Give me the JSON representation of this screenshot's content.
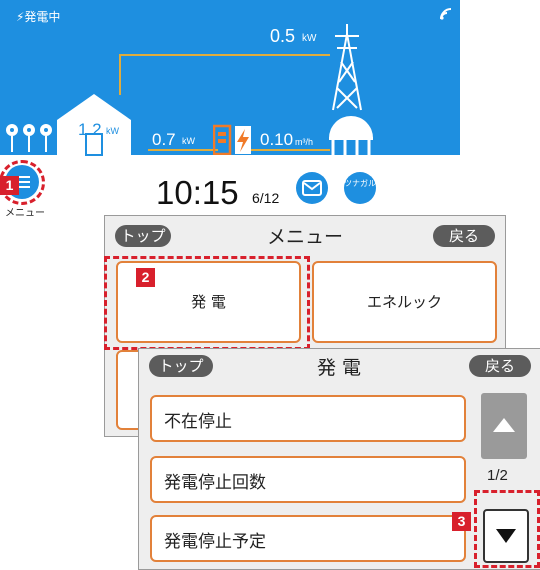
{
  "home": {
    "status": "⚡発電中",
    "power_top": "0.5",
    "house_power": "1.2",
    "power_mid": "0.7",
    "gas_flow": "0.10",
    "unit_kw": "kW",
    "unit_gas": "m³/h",
    "time": "10:15",
    "date": "6/12",
    "menu_label": "メニュー",
    "gas_icon_text": "ツナガル"
  },
  "menu_screen": {
    "top_btn": "トップ",
    "title": "メニュー",
    "back_btn": "戻る",
    "items": [
      "発 電",
      "エネルック"
    ]
  },
  "hatsuden_screen": {
    "top_btn": "トップ",
    "title": "発 電",
    "back_btn": "戻る",
    "items": [
      "不在停止",
      "発電停止回数",
      "発電停止予定"
    ],
    "page": "1/2"
  },
  "callouts": [
    "1",
    "2",
    "3"
  ],
  "colors": {
    "screen_blue": "#1e8fe0",
    "line_gold": "#e0ac3c",
    "accent_orange": "#e2813a",
    "callout_red": "#d8202c"
  }
}
